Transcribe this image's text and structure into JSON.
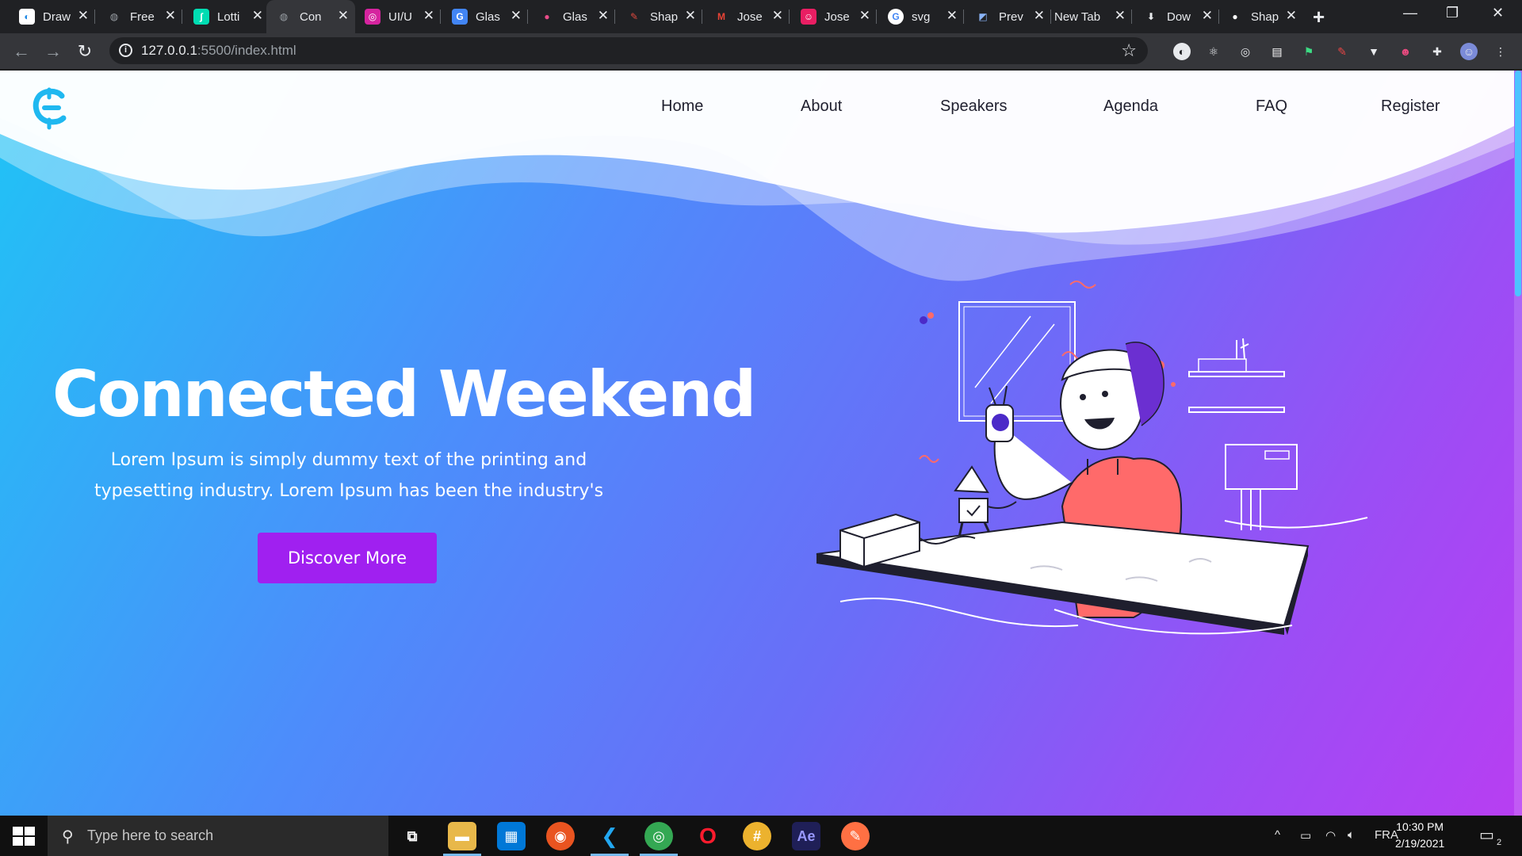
{
  "browser": {
    "tabs": [
      {
        "title": "Draw",
        "favicon": "drawio-icon",
        "color": "#ffffff"
      },
      {
        "title": "Free",
        "favicon": "globe-icon",
        "color": "#9aa0a6"
      },
      {
        "title": "Lotti",
        "favicon": "lottie-icon",
        "color": "#00ddb3"
      },
      {
        "title": "Con",
        "favicon": "globe-icon",
        "color": "#9aa0a6",
        "active": true
      },
      {
        "title": "UI/U",
        "favicon": "instagram-icon",
        "color": "#d6249f"
      },
      {
        "title": "Glas",
        "favicon": "google-docs-icon",
        "color": "#4285f4"
      },
      {
        "title": "Glas",
        "favicon": "dribbble-icon",
        "color": "#ea4c89"
      },
      {
        "title": "Shap",
        "favicon": "shape-icon",
        "color": "#e04a3f"
      },
      {
        "title": "Jose",
        "favicon": "gmail-icon",
        "color": "#ea4335"
      },
      {
        "title": "Jose",
        "favicon": "profile-icon",
        "color": "#e91e63"
      },
      {
        "title": "svg",
        "favicon": "google-icon",
        "color": "#4285f4"
      },
      {
        "title": "Prev",
        "favicon": "preview-icon",
        "color": "#8ab4f8"
      },
      {
        "title": "New Tab",
        "favicon": "",
        "color": "#202124"
      },
      {
        "title": "Dow",
        "favicon": "download-icon",
        "color": "#e8eaed"
      },
      {
        "title": "Shap",
        "favicon": "shape-icon",
        "color": "#ffffff"
      }
    ],
    "url_host": "127.0.0.1",
    "url_path": ":5500/index.html"
  },
  "site": {
    "nav": {
      "home": "Home",
      "about": "About",
      "speakers": "Speakers",
      "agenda": "Agenda",
      "faq": "FAQ",
      "register": "Register"
    },
    "hero": {
      "title": "Connected Weekend",
      "subtitle": "Lorem Ipsum is simply dummy text of the printing and typesetting industry. Lorem Ipsum has been the industry's",
      "cta": "Discover More"
    },
    "colors": {
      "accent": "#a020f0",
      "gradient_start": "#1fc4f5",
      "gradient_end": "#b83ef2",
      "logo": "#1fb8f0"
    }
  },
  "taskbar": {
    "search_placeholder": "Type here to search",
    "language": "FRA",
    "time": "10:30 PM",
    "date": "2/19/2021",
    "notification_count": "2"
  }
}
